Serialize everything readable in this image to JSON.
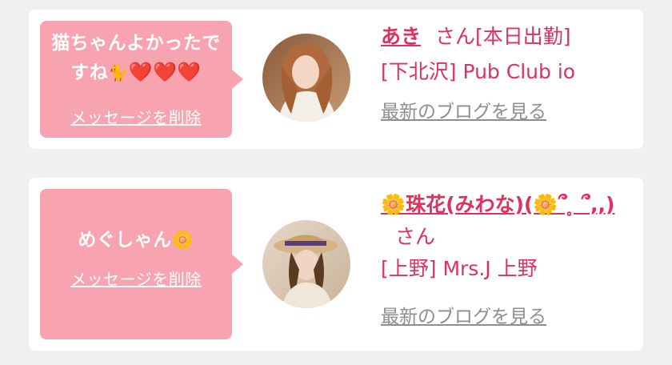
{
  "entries": [
    {
      "message_text": "猫ちゃんよかったですね",
      "message_emoji_cat": "🐈",
      "message_emoji_hearts": "❤️❤️❤️",
      "delete_label": "メッセージを削除",
      "name": "あき",
      "honorific": "さん",
      "status": "[本日出勤]",
      "shop": "[下北沢] Pub Club io",
      "blog_label": "最新のブログを見る",
      "avatar_icon": "profile-photo-avatar"
    },
    {
      "message_text": "めぐしゃん",
      "message_emoji_flower": "🌼",
      "delete_label": "メッセージを削除",
      "name": "🌼珠花(みわな)(🌼՞ ̥ ՞,,)",
      "honorific": "さん",
      "shop": "[上野] Mrs.J 上野",
      "blog_label": "最新のブログを見る",
      "avatar_icon": "profile-photo-avatar"
    }
  ],
  "colors": {
    "background": "#f0f0f0",
    "card": "#ffffff",
    "bubble": "#f8a3b0",
    "accent": "#e0305c",
    "link_gray": "#8e8e8e"
  }
}
